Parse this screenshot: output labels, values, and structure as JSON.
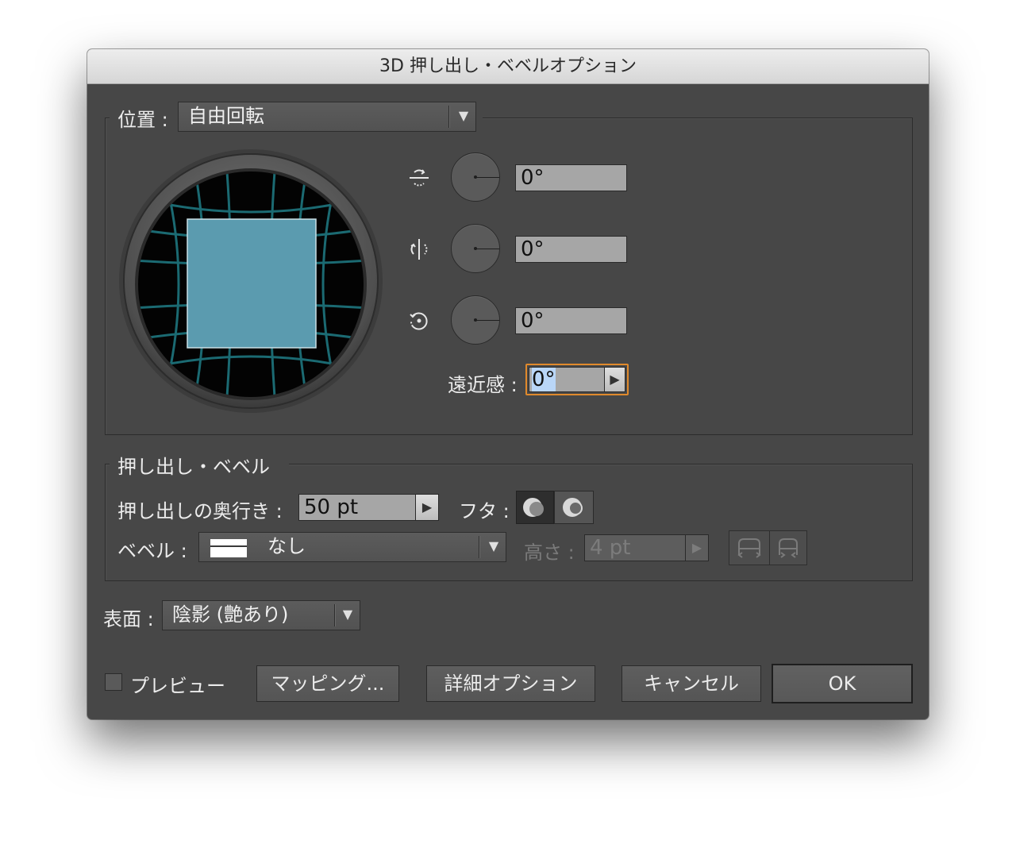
{
  "window": {
    "title": "3D 押し出し・ベベルオプション"
  },
  "position": {
    "label": "位置 :",
    "preset_value": "自由回転",
    "axes": [
      {
        "axis": "x",
        "icon": "rotate-x-axis-icon",
        "value": "0°"
      },
      {
        "axis": "y",
        "icon": "rotate-y-axis-icon",
        "value": "0°"
      },
      {
        "axis": "z",
        "icon": "rotate-z-axis-icon",
        "value": "0°"
      }
    ],
    "perspective_label": "遠近感 :",
    "perspective_value": "0°"
  },
  "extrude": {
    "group_label": "押し出し・ベベル",
    "depth_label": "押し出しの奥行き :",
    "depth_value": "50 pt",
    "cap_label": "フタ :",
    "bevel_label": "ベベル :",
    "bevel_value": "なし",
    "height_label": "高さ :",
    "height_value": "4 pt"
  },
  "surface": {
    "label": "表面 :",
    "value": "陰影 (艶あり)"
  },
  "footer": {
    "preview_label": "プレビュー",
    "preview_checked": false,
    "mapping_label": "マッピング...",
    "more_options_label": "詳細オプション",
    "cancel_label": "キャンセル",
    "ok_label": "OK"
  },
  "colors": {
    "dialog_bg": "#474747",
    "preview_square": "#5b9baf",
    "grid_lines": "#1b6a72",
    "focus_ring": "#e08a2c"
  }
}
